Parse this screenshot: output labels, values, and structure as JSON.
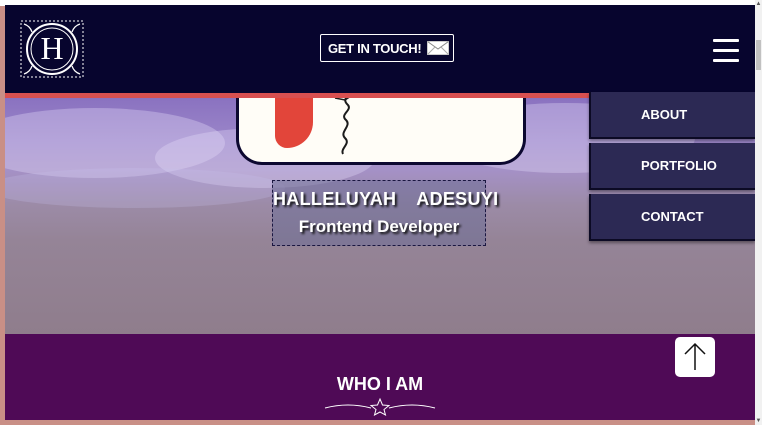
{
  "header": {
    "logo_letter": "H",
    "cta_label": "GET IN TOUCH!",
    "cta_icon": "envelope-icon",
    "menu_icon": "hamburger-icon"
  },
  "hero": {
    "name": "HALLELUYAH  ADESUYI",
    "role": "Frontend Developer"
  },
  "nav_menu": {
    "items": [
      {
        "label": "ABOUT"
      },
      {
        "label": "PORTFOLIO"
      },
      {
        "label": "CONTACT"
      }
    ]
  },
  "section": {
    "title": "WHO I AM",
    "ornament_icon": "star-divider-icon",
    "back_to_top_icon": "arrow-up-icon"
  },
  "colors": {
    "header_bg": "#07052e",
    "section_bg": "#4f0a56",
    "menu_bg": "#2c2954",
    "accent_red": "#d85050"
  }
}
